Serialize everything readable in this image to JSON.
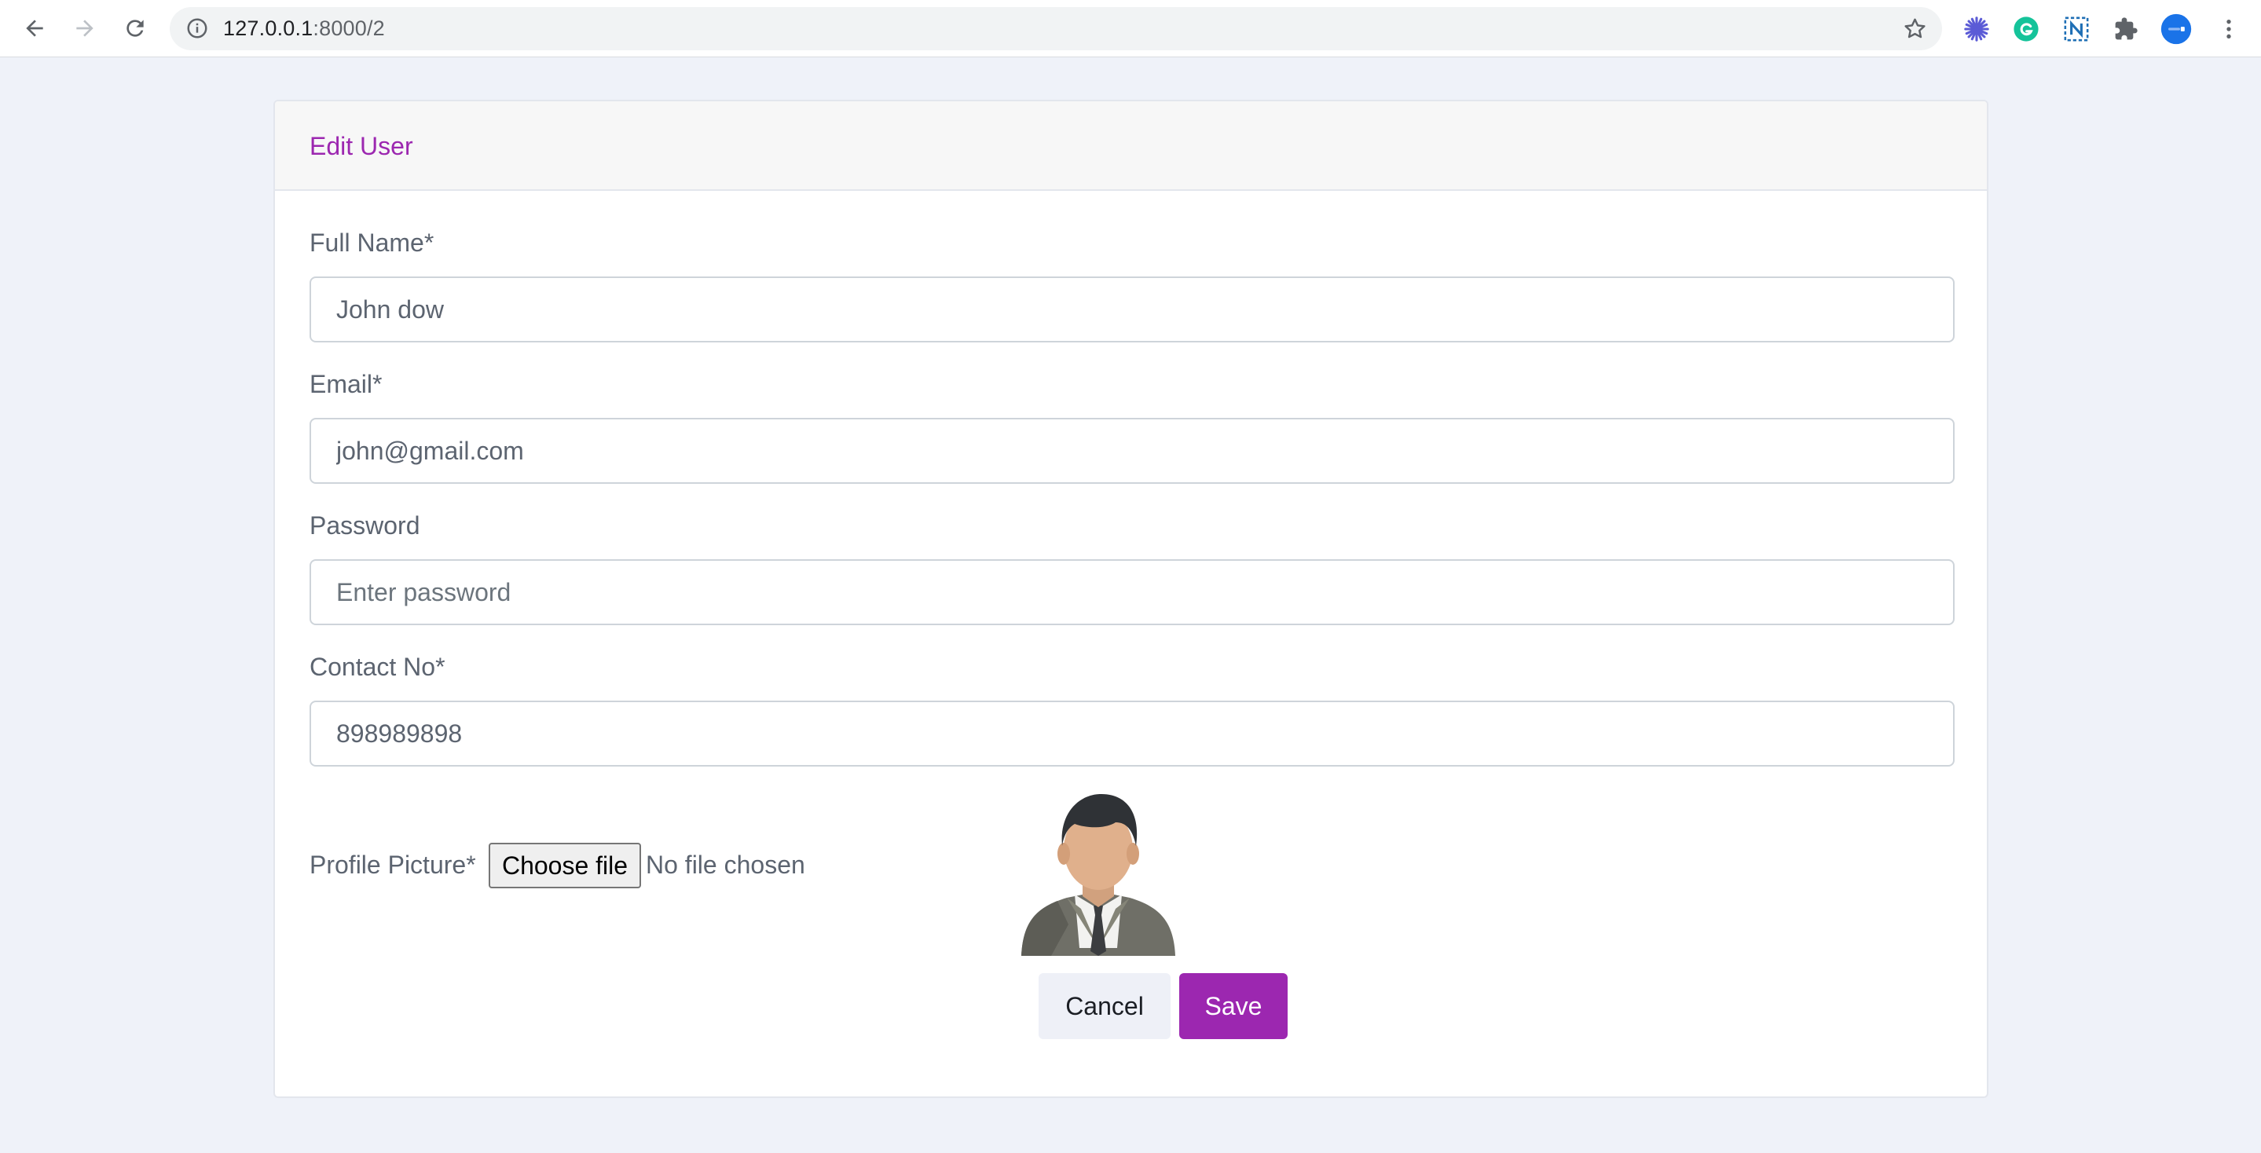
{
  "browser": {
    "url_host": "127.0.0.1",
    "url_rest": ":8000/2"
  },
  "form": {
    "title": "Edit User",
    "fields": [
      {
        "label": "Full Name*",
        "value": "John dow",
        "placeholder": ""
      },
      {
        "label": "Email*",
        "value": "john@gmail.com",
        "placeholder": ""
      },
      {
        "label": "Password",
        "value": "",
        "placeholder": "Enter password"
      },
      {
        "label": "Contact No*",
        "value": "898989898",
        "placeholder": ""
      }
    ],
    "profile_picture": {
      "label": "Profile Picture*",
      "button_label": "Choose file",
      "status": "No file chosen"
    },
    "cancel_label": "Cancel",
    "save_label": "Save"
  },
  "colors": {
    "accent": "#9c27b0",
    "page_background": "#eff2f9"
  }
}
